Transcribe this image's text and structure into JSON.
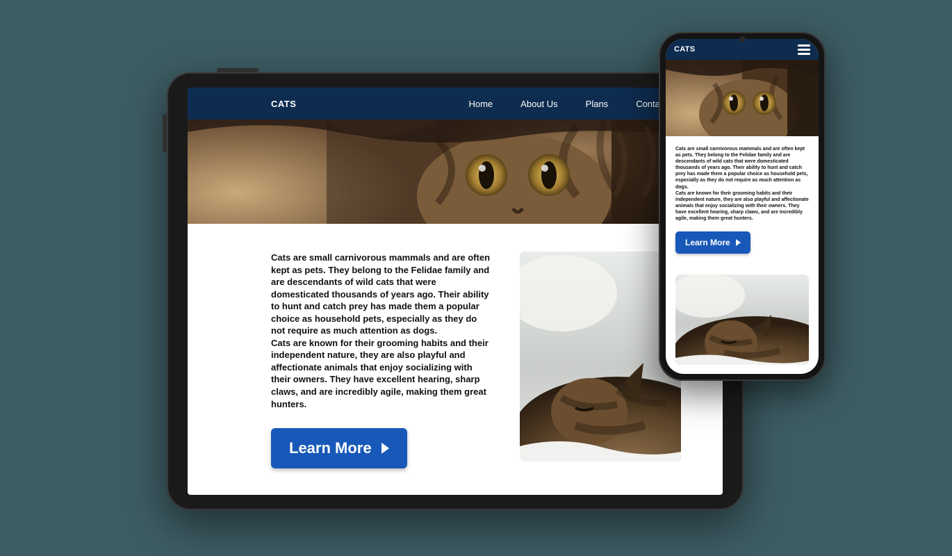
{
  "brand": "CATS",
  "nav": {
    "home": "Home",
    "about": "About Us",
    "plans": "Plans",
    "contact": "Contact"
  },
  "article": {
    "paragraph1": "Cats are small carnivorous mammals and are often kept as pets. They belong to the Felidae family and are descendants of wild cats that were domesticated thousands of years ago. Their ability to hunt and catch prey has made them a popular choice as household pets, especially as they do not require as much attention as dogs.",
    "paragraph2": "Cats are known for their grooming habits and their independent nature, they are also playful and affectionate animals that enjoy socializing with their owners. They have excellent hearing, sharp claws, and are incredibly agile, making them great hunters."
  },
  "cta": {
    "label": "Learn More"
  },
  "colors": {
    "header": "#0e2c4f",
    "button": "#1858b8",
    "background": "#3d5c63"
  }
}
